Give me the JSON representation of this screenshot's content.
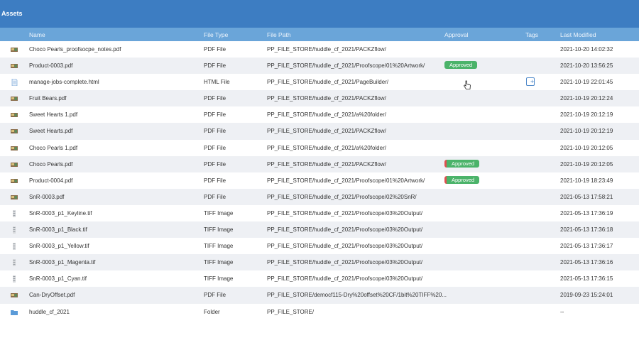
{
  "title": "Assets",
  "columns": {
    "name": "Name",
    "file_type": "File Type",
    "file_path": "File Path",
    "approval": "Approval",
    "tags": "Tags",
    "last_modified": "Last Modified"
  },
  "rows": [
    {
      "name": "Choco Pearls_proofsocpe_notes.pdf",
      "type": "PDF File",
      "path": "PP_FILE_STORE/huddle_cf_2021/PACKZflow/",
      "approval": "",
      "modified": "2021-10-20 14:02:32",
      "thumb": "pdf-thumbnail-icon"
    },
    {
      "name": "Product-0003.pdf",
      "type": "PDF File",
      "path": "PP_FILE_STORE/huddle_cf_2021/Proofscope/01%20Artwork/",
      "approval": "Approved",
      "modified": "2021-10-20 13:56:25",
      "thumb": "pdf-thumbnail-icon"
    },
    {
      "name": "manage-jobs-complete.html",
      "type": "HTML File",
      "path": "PP_FILE_STORE/huddle_cf_2021/PageBuilder/",
      "approval": "",
      "modified": "2021-10-19 22:01:45",
      "thumb": "html-file-icon"
    },
    {
      "name": "Fruit Bears.pdf",
      "type": "PDF File",
      "path": "PP_FILE_STORE/huddle_cf_2021/PACKZflow/",
      "approval": "",
      "modified": "2021-10-19 20:12:24",
      "thumb": "pdf-thumbnail-icon"
    },
    {
      "name": "Sweet Hearts 1.pdf",
      "type": "PDF File",
      "path": "PP_FILE_STORE/huddle_cf_2021/a%20folder/",
      "approval": "",
      "modified": "2021-10-19 20:12:19",
      "thumb": "pdf-thumbnail-icon"
    },
    {
      "name": "Sweet Hearts.pdf",
      "type": "PDF File",
      "path": "PP_FILE_STORE/huddle_cf_2021/PACKZflow/",
      "approval": "",
      "modified": "2021-10-19 20:12:19",
      "thumb": "pdf-thumbnail-icon"
    },
    {
      "name": "Choco Pearls 1.pdf",
      "type": "PDF File",
      "path": "PP_FILE_STORE/huddle_cf_2021/a%20folder/",
      "approval": "",
      "modified": "2021-10-19 20:12:05",
      "thumb": "pdf-thumbnail-icon"
    },
    {
      "name": "Choco Pearls.pdf",
      "type": "PDF File",
      "path": "PP_FILE_STORE/huddle_cf_2021/PACKZflow/",
      "approval": "Approved",
      "modified": "2021-10-19 20:12:05",
      "thumb": "pdf-thumbnail-icon"
    },
    {
      "name": "Product-0004.pdf",
      "type": "PDF File",
      "path": "PP_FILE_STORE/huddle_cf_2021/Proofscope/01%20Artwork/",
      "approval": "Approved",
      "modified": "2021-10-19 18:23:49",
      "thumb": "pdf-thumbnail-icon"
    },
    {
      "name": "SnR-0003.pdf",
      "type": "PDF File",
      "path": "PP_FILE_STORE/huddle_cf_2021/Proofscope/02%20SnR/",
      "approval": "",
      "modified": "2021-05-13 17:58:21",
      "thumb": "pdf-thumbnail-icon"
    },
    {
      "name": "SnR-0003_p1_Keyline.tif",
      "type": "TIFF Image",
      "path": "PP_FILE_STORE/huddle_cf_2021/Proofscope/03%20Output/",
      "approval": "",
      "modified": "2021-05-13 17:36:19",
      "thumb": "tiff-thumbnail-icon"
    },
    {
      "name": "SnR-0003_p1_Black.tif",
      "type": "TIFF Image",
      "path": "PP_FILE_STORE/huddle_cf_2021/Proofscope/03%20Output/",
      "approval": "",
      "modified": "2021-05-13 17:36:18",
      "thumb": "tiff-thumbnail-icon"
    },
    {
      "name": "SnR-0003_p1_Yellow.tif",
      "type": "TIFF Image",
      "path": "PP_FILE_STORE/huddle_cf_2021/Proofscope/03%20Output/",
      "approval": "",
      "modified": "2021-05-13 17:36:17",
      "thumb": "tiff-thumbnail-icon"
    },
    {
      "name": "SnR-0003_p1_Magenta.tif",
      "type": "TIFF Image",
      "path": "PP_FILE_STORE/huddle_cf_2021/Proofscope/03%20Output/",
      "approval": "",
      "modified": "2021-05-13 17:36:16",
      "thumb": "tiff-thumbnail-icon"
    },
    {
      "name": "SnR-0003_p1_Cyan.tif",
      "type": "TIFF Image",
      "path": "PP_FILE_STORE/huddle_cf_2021/Proofscope/03%20Output/",
      "approval": "",
      "modified": "2021-05-13 17:36:15",
      "thumb": "tiff-thumbnail-icon"
    },
    {
      "name": "Can-DryOffset.pdf",
      "type": "PDF File",
      "path": "PP_FILE_STORE/democf115-Dry%20offset%20CF/1bit%20TIFF%20...",
      "approval": "",
      "modified": "2019-09-23 15:24:01",
      "thumb": "pdf-thumbnail-icon"
    },
    {
      "name": "huddle_cf_2021",
      "type": "Folder",
      "path": "PP_FILE_STORE/",
      "approval": "",
      "modified": "--",
      "thumb": "folder-icon"
    }
  ],
  "icons": {
    "add_tag": "plus-icon",
    "cursor": "mouse-pointer-hand-icon"
  },
  "colors": {
    "topbar": "#3d7dc2",
    "header": "#6aa5d9",
    "approved_badge": "#4bb36a",
    "row_alt": "#eef0f4",
    "flag": "#e05050"
  }
}
